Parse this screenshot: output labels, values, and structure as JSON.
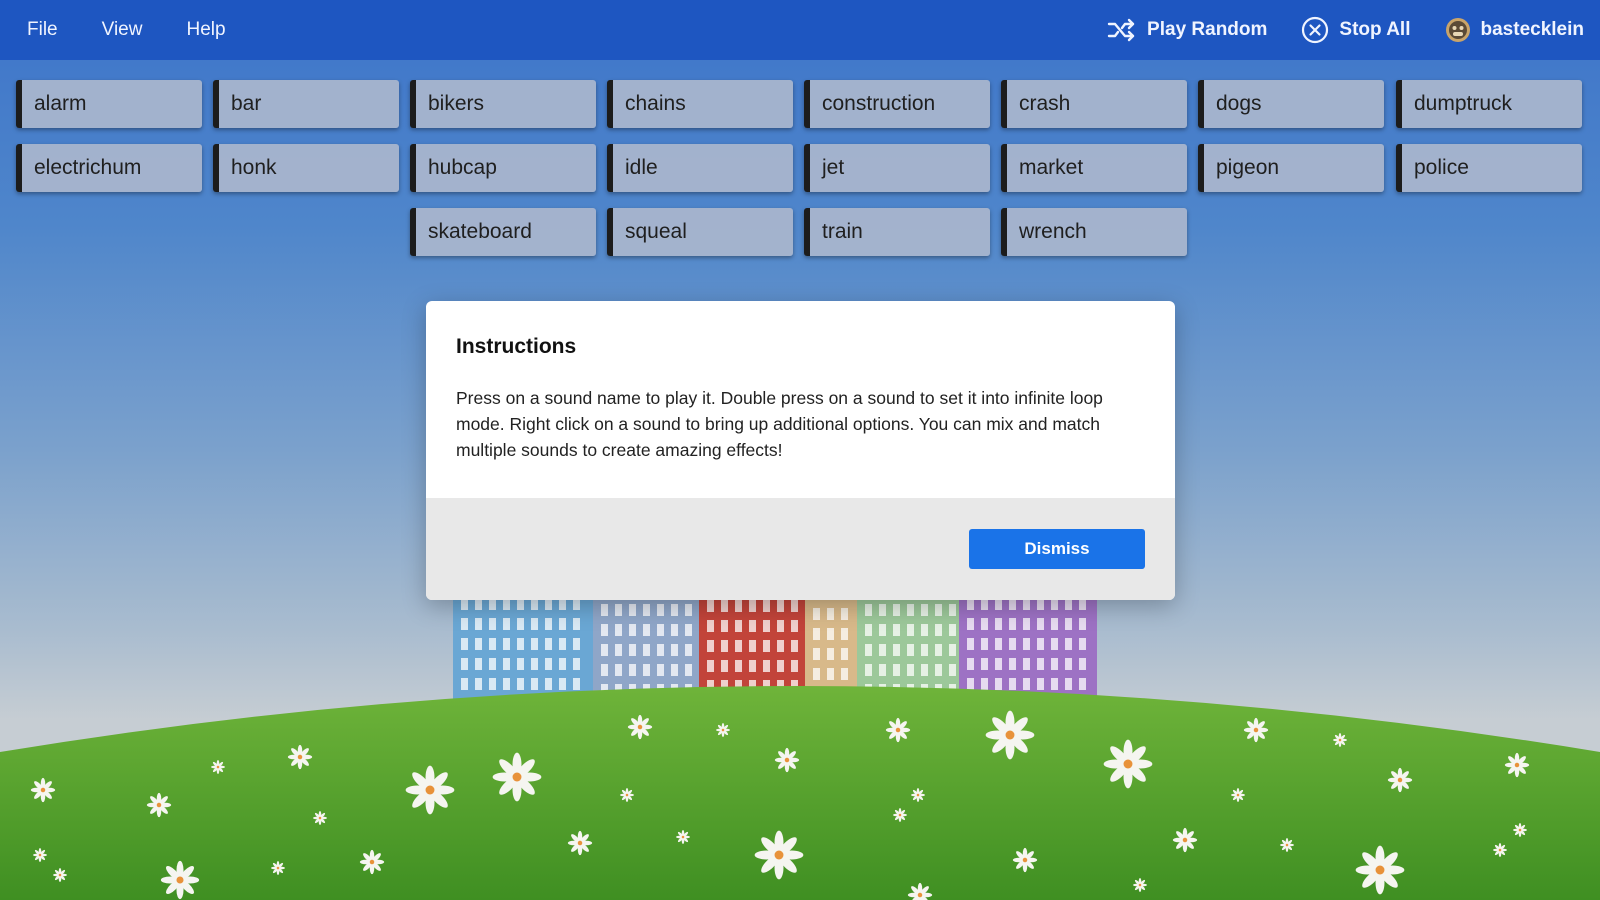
{
  "menu": {
    "file": "File",
    "view": "View",
    "help": "Help",
    "play_random": "Play Random",
    "stop_all": "Stop All",
    "username": "bastecklein"
  },
  "sounds": [
    "alarm",
    "bar",
    "bikers",
    "chains",
    "construction",
    "crash",
    "dogs",
    "dumptruck",
    "electrichum",
    "honk",
    "hubcap",
    "idle",
    "jet",
    "market",
    "pigeon",
    "police",
    "skateboard",
    "squeal",
    "train",
    "wrench"
  ],
  "dialog": {
    "title": "Instructions",
    "body": "Press on a sound name to play it. Double press on a sound to set it into infinite loop mode. Right click on a sound to bring up additional options. You can mix and match multiple sounds to create amazing effects!",
    "dismiss": "Dismiss"
  },
  "colors": {
    "menubar": "#1e56c1",
    "button_primary": "#1a73e8",
    "grass": "#5fa32e"
  },
  "icons": [
    "shuffle-icon",
    "close-circle-icon",
    "avatar-icon",
    "flower-icon",
    "building-icon"
  ]
}
